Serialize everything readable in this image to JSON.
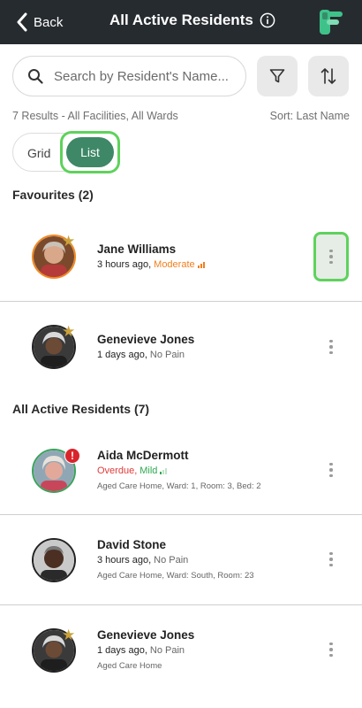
{
  "header": {
    "back_label": "Back",
    "title": "All Active Residents"
  },
  "search": {
    "placeholder": "Search by Resident's Name..."
  },
  "results_text": "7 Results - All Facilities, All Wards",
  "sort_text": "Sort: Last Name",
  "view_toggle": {
    "grid_label": "Grid",
    "list_label": "List",
    "selected": "List"
  },
  "favourites": {
    "heading": "Favourites (2)",
    "residents": [
      {
        "name": "Jane Williams",
        "time": "3 hours ago,",
        "pain": "Moderate",
        "pain_level": "moderate",
        "favourite": true
      },
      {
        "name": "Genevieve Jones",
        "time": "1 days ago,",
        "pain": "No Pain",
        "pain_level": "none",
        "favourite": true
      }
    ]
  },
  "all_residents": {
    "heading": "All Active Residents (7)",
    "residents": [
      {
        "name": "Aida McDermott",
        "status": "Overdue,",
        "pain": "Mild",
        "pain_level": "mild",
        "location": "Aged Care Home, Ward: 1, Room: 3, Bed: 2",
        "alert": "!"
      },
      {
        "name": "David Stone",
        "time": "3 hours ago,",
        "pain": "No Pain",
        "location": "Aged Care Home, Ward: South, Room: 23"
      },
      {
        "name": "Genevieve Jones",
        "time": "1 days ago,",
        "pain": "No Pain",
        "location": "Aged Care Home",
        "favourite": true
      }
    ]
  },
  "colors": {
    "header_bg": "#262b2f",
    "accent_green": "#3e8867",
    "highlight_green": "#5ed25c",
    "moderate_orange": "#f07f1e",
    "mild_green": "#2fa84f",
    "overdue_red": "#e03a3a",
    "favourite_star": "#c9a23a"
  },
  "icons": [
    "chevron-left-icon",
    "info-icon",
    "app-logo",
    "search-icon",
    "filter-icon",
    "sort-arrows-icon",
    "favourite-star-icon",
    "more-vertical-icon",
    "alert-icon",
    "signal-bars-icon"
  ]
}
